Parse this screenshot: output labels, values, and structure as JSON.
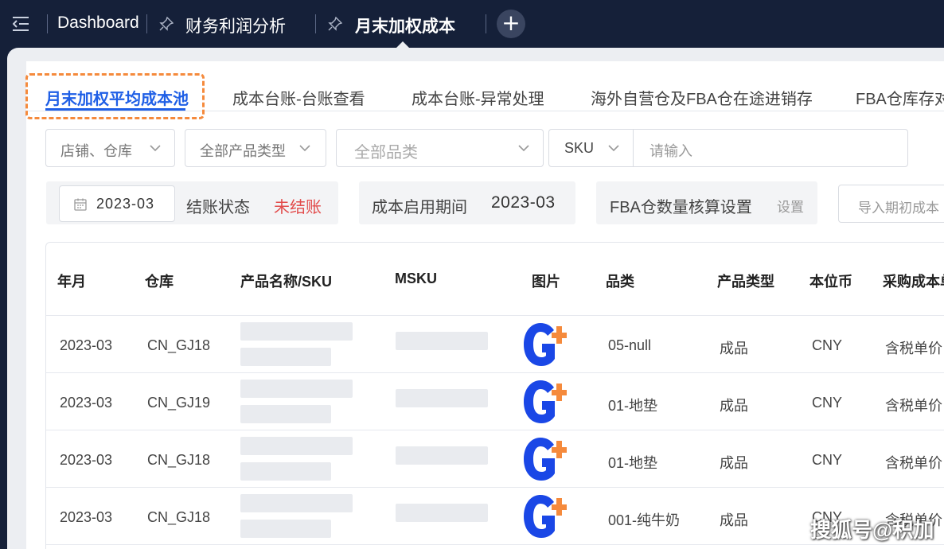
{
  "top_tabs": [
    {
      "label": "Dashboard"
    },
    {
      "label": "财务利润分析"
    },
    {
      "label": "月末加权成本"
    }
  ],
  "add_tab_label": "+",
  "sub_tabs": [
    {
      "label": "月末加权平均成本池"
    },
    {
      "label": "成本台账-台账查看"
    },
    {
      "label": "成本台账-异常处理"
    },
    {
      "label": "海外自营仓及FBA仓在途进销存"
    },
    {
      "label": "FBA仓库存对"
    }
  ],
  "filters": {
    "shop_warehouse": "店铺、仓库",
    "product_type": "全部产品类型",
    "category": "全部品类",
    "sku_select": "SKU",
    "search_placeholder": "请输入"
  },
  "settlement": {
    "month": "2023-03",
    "status_label": "结账状态",
    "status_value": "未结账"
  },
  "cost_period": {
    "label": "成本启用期间",
    "value": "2023-03"
  },
  "fba_setting": {
    "label": "FBA仓数量核算设置",
    "link": "设置"
  },
  "import_button": "导入期初成本",
  "table": {
    "headers": [
      "年月",
      "仓库",
      "产品名称/SKU",
      "MSKU",
      "图片",
      "品类",
      "产品类型",
      "本位币",
      "采购成本单"
    ],
    "rows": [
      {
        "month": "2023-03",
        "warehouse": "CN_GJ18",
        "category": "05-null",
        "type": "成品",
        "currency": "CNY",
        "cost": "含税单价"
      },
      {
        "month": "2023-03",
        "warehouse": "CN_GJ19",
        "category": "01-地垫",
        "type": "成品",
        "currency": "CNY",
        "cost": "含税单价"
      },
      {
        "month": "2023-03",
        "warehouse": "CN_GJ18",
        "category": "01-地垫",
        "type": "成品",
        "currency": "CNY",
        "cost": "含税单价"
      },
      {
        "month": "2023-03",
        "warehouse": "CN_GJ18",
        "category": "001-纯牛奶",
        "type": "成品",
        "currency": "CNY",
        "cost": "含税单价"
      }
    ]
  },
  "colors": {
    "accent": "#1f5fe6",
    "highlight": "#f58a3c",
    "status_red": "#e24c4c",
    "top_bar": "#152039"
  },
  "watermark": "搜狐号@积加"
}
